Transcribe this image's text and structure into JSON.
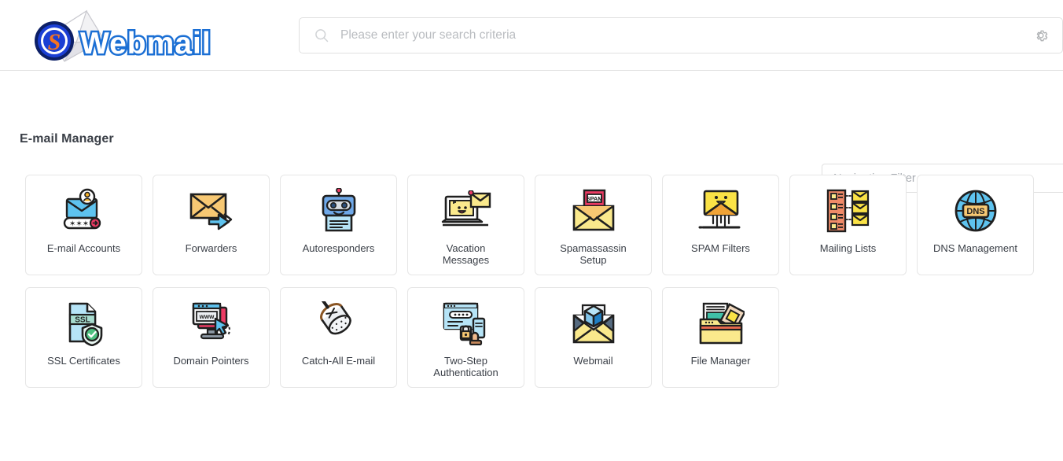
{
  "brand": {
    "name": "Webmail",
    "logo_letter": "S",
    "logo_text_color": "#1b6fd4",
    "logo_badge_color": "#1b3fd4",
    "logo_letter_color": "#f47321"
  },
  "header": {
    "search": {
      "placeholder": "Please enter your search criteria",
      "value": "",
      "icon": "search-icon"
    },
    "settings_icon": "gear-icon"
  },
  "navigation_filter": {
    "placeholder": "Navigation Filter",
    "value": ""
  },
  "section": {
    "title": "E-mail Manager"
  },
  "colors": {
    "background": "#ffffff",
    "border": "#e6e6e6",
    "text": "#3a3f47",
    "placeholder": "#b9bcc0"
  },
  "tiles": [
    {
      "label": "E-mail Accounts",
      "icon": "email-accounts-icon"
    },
    {
      "label": "Forwarders",
      "icon": "forwarders-icon"
    },
    {
      "label": "Autoresponders",
      "icon": "autoresponders-icon"
    },
    {
      "label": "Vacation\nMessages",
      "icon": "vacation-messages-icon"
    },
    {
      "label": "Spamassassin\nSetup",
      "icon": "spamassassin-setup-icon"
    },
    {
      "label": "SPAM Filters",
      "icon": "spam-filters-icon"
    },
    {
      "label": "Mailing Lists",
      "icon": "mailing-lists-icon"
    },
    {
      "label": "DNS Management",
      "icon": "dns-management-icon"
    },
    {
      "label": "SSL Certificates",
      "icon": "ssl-certificates-icon"
    },
    {
      "label": "Domain Pointers",
      "icon": "domain-pointers-icon"
    },
    {
      "label": "Catch-All E-mail",
      "icon": "catch-all-email-icon"
    },
    {
      "label": "Two-Step\nAuthentication",
      "icon": "two-step-authentication-icon"
    },
    {
      "label": "Webmail",
      "icon": "webmail-icon"
    },
    {
      "label": "File Manager",
      "icon": "file-manager-icon"
    }
  ]
}
